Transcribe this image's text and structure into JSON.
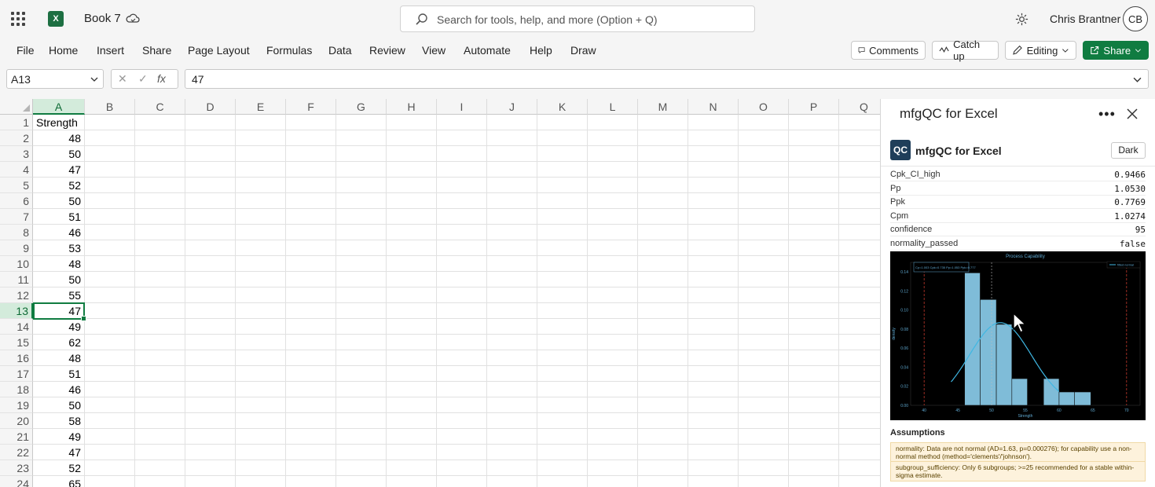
{
  "title_bar": {
    "doc_title": "Book 7",
    "search_placeholder": "Search for tools, help, and more (Option + Q)",
    "user_name": "Chris Brantner",
    "user_initials": "CB",
    "app_logo": "X"
  },
  "ribbon": {
    "tabs": [
      "File",
      "Home",
      "Insert",
      "Share",
      "Page Layout",
      "Formulas",
      "Data",
      "Review",
      "View",
      "Automate",
      "Help",
      "Draw"
    ],
    "comments": "Comments",
    "catch_up": "Catch up",
    "editing": "Editing",
    "share": "Share"
  },
  "formula_bar": {
    "name_box": "A13",
    "fx": "fx",
    "value": "47"
  },
  "grid": {
    "columns": [
      "A",
      "B",
      "C",
      "D",
      "E",
      "F",
      "G",
      "H",
      "I",
      "J",
      "K",
      "L",
      "M",
      "N",
      "O",
      "P",
      "Q"
    ],
    "selected_column": "A",
    "selected_row": "13",
    "rows": [
      {
        "n": "1",
        "a": "Strength"
      },
      {
        "n": "2",
        "a": "48"
      },
      {
        "n": "3",
        "a": "50"
      },
      {
        "n": "4",
        "a": "47"
      },
      {
        "n": "5",
        "a": "52"
      },
      {
        "n": "6",
        "a": "50"
      },
      {
        "n": "7",
        "a": "51"
      },
      {
        "n": "8",
        "a": "46"
      },
      {
        "n": "9",
        "a": "53"
      },
      {
        "n": "10",
        "a": "48"
      },
      {
        "n": "11",
        "a": "50"
      },
      {
        "n": "12",
        "a": "55"
      },
      {
        "n": "13",
        "a": "47"
      },
      {
        "n": "14",
        "a": "49"
      },
      {
        "n": "15",
        "a": "62"
      },
      {
        "n": "16",
        "a": "48"
      },
      {
        "n": "17",
        "a": "51"
      },
      {
        "n": "18",
        "a": "46"
      },
      {
        "n": "19",
        "a": "50"
      },
      {
        "n": "20",
        "a": "58"
      },
      {
        "n": "21",
        "a": "49"
      },
      {
        "n": "22",
        "a": "47"
      },
      {
        "n": "23",
        "a": "52"
      },
      {
        "n": "24",
        "a": "65"
      }
    ]
  },
  "task_pane": {
    "title": "mfgQC for Excel",
    "addin_name": "mfgQC for Excel",
    "logo": "QC",
    "theme_button": "Dark",
    "stats": [
      {
        "key": "Cpk_CI_high",
        "value": "0.9466"
      },
      {
        "key": "Pp",
        "value": "1.0530"
      },
      {
        "key": "Ppk",
        "value": "0.7769"
      },
      {
        "key": "Cpm",
        "value": "1.0274"
      },
      {
        "key": "confidence",
        "value": "95"
      },
      {
        "key": "normality_passed",
        "value": "false"
      }
    ],
    "assumptions_heading": "Assumptions",
    "notes": [
      "normality: Data are not normal (AD=1.63, p=0.000276); for capability use a non-normal method (method='clements'/'johnson').",
      "subgroup_sufficiency: Only 6 subgroups; >=25 recommended for a stable within-sigma estimate."
    ]
  },
  "chart_data": {
    "type": "bar",
    "title": "Process Capability",
    "xlabel": "Strength",
    "ylabel": "density",
    "xlim": [
      38,
      72
    ],
    "ylim": [
      0,
      0.15
    ],
    "x_ticks": [
      "40",
      "45",
      "50",
      "55",
      "60",
      "65",
      "70"
    ],
    "y_ticks": [
      "0.00",
      "0.02",
      "0.04",
      "0.06",
      "0.08",
      "0.10",
      "0.12",
      "0.14"
    ],
    "bins": [
      {
        "from": 46,
        "to": 48.3,
        "density": 0.139
      },
      {
        "from": 48.3,
        "to": 50.7,
        "density": 0.111
      },
      {
        "from": 50.7,
        "to": 53.0,
        "density": 0.085
      },
      {
        "from": 53.0,
        "to": 55.3,
        "density": 0.028
      },
      {
        "from": 55.3,
        "to": 57.7,
        "density": 0.0
      },
      {
        "from": 57.7,
        "to": 60.0,
        "density": 0.028
      },
      {
        "from": 60.0,
        "to": 62.3,
        "density": 0.014
      },
      {
        "from": 62.3,
        "to": 64.7,
        "density": 0.014
      }
    ],
    "fitted_normal": {
      "name": "fitted normal",
      "mean": 51.3,
      "sd": 4.6
    },
    "lsl": 40,
    "usl": 70,
    "mean_line": 50,
    "stats_box": "Cp=1.003 Cpk=0.735 Pp=1.053 Ppk=0.777",
    "colors": {
      "bar": "#7fbcd8",
      "curve": "#3fb7e3",
      "spec": "#c0392b",
      "background": "#000000",
      "text": "#5fa8d0"
    }
  }
}
